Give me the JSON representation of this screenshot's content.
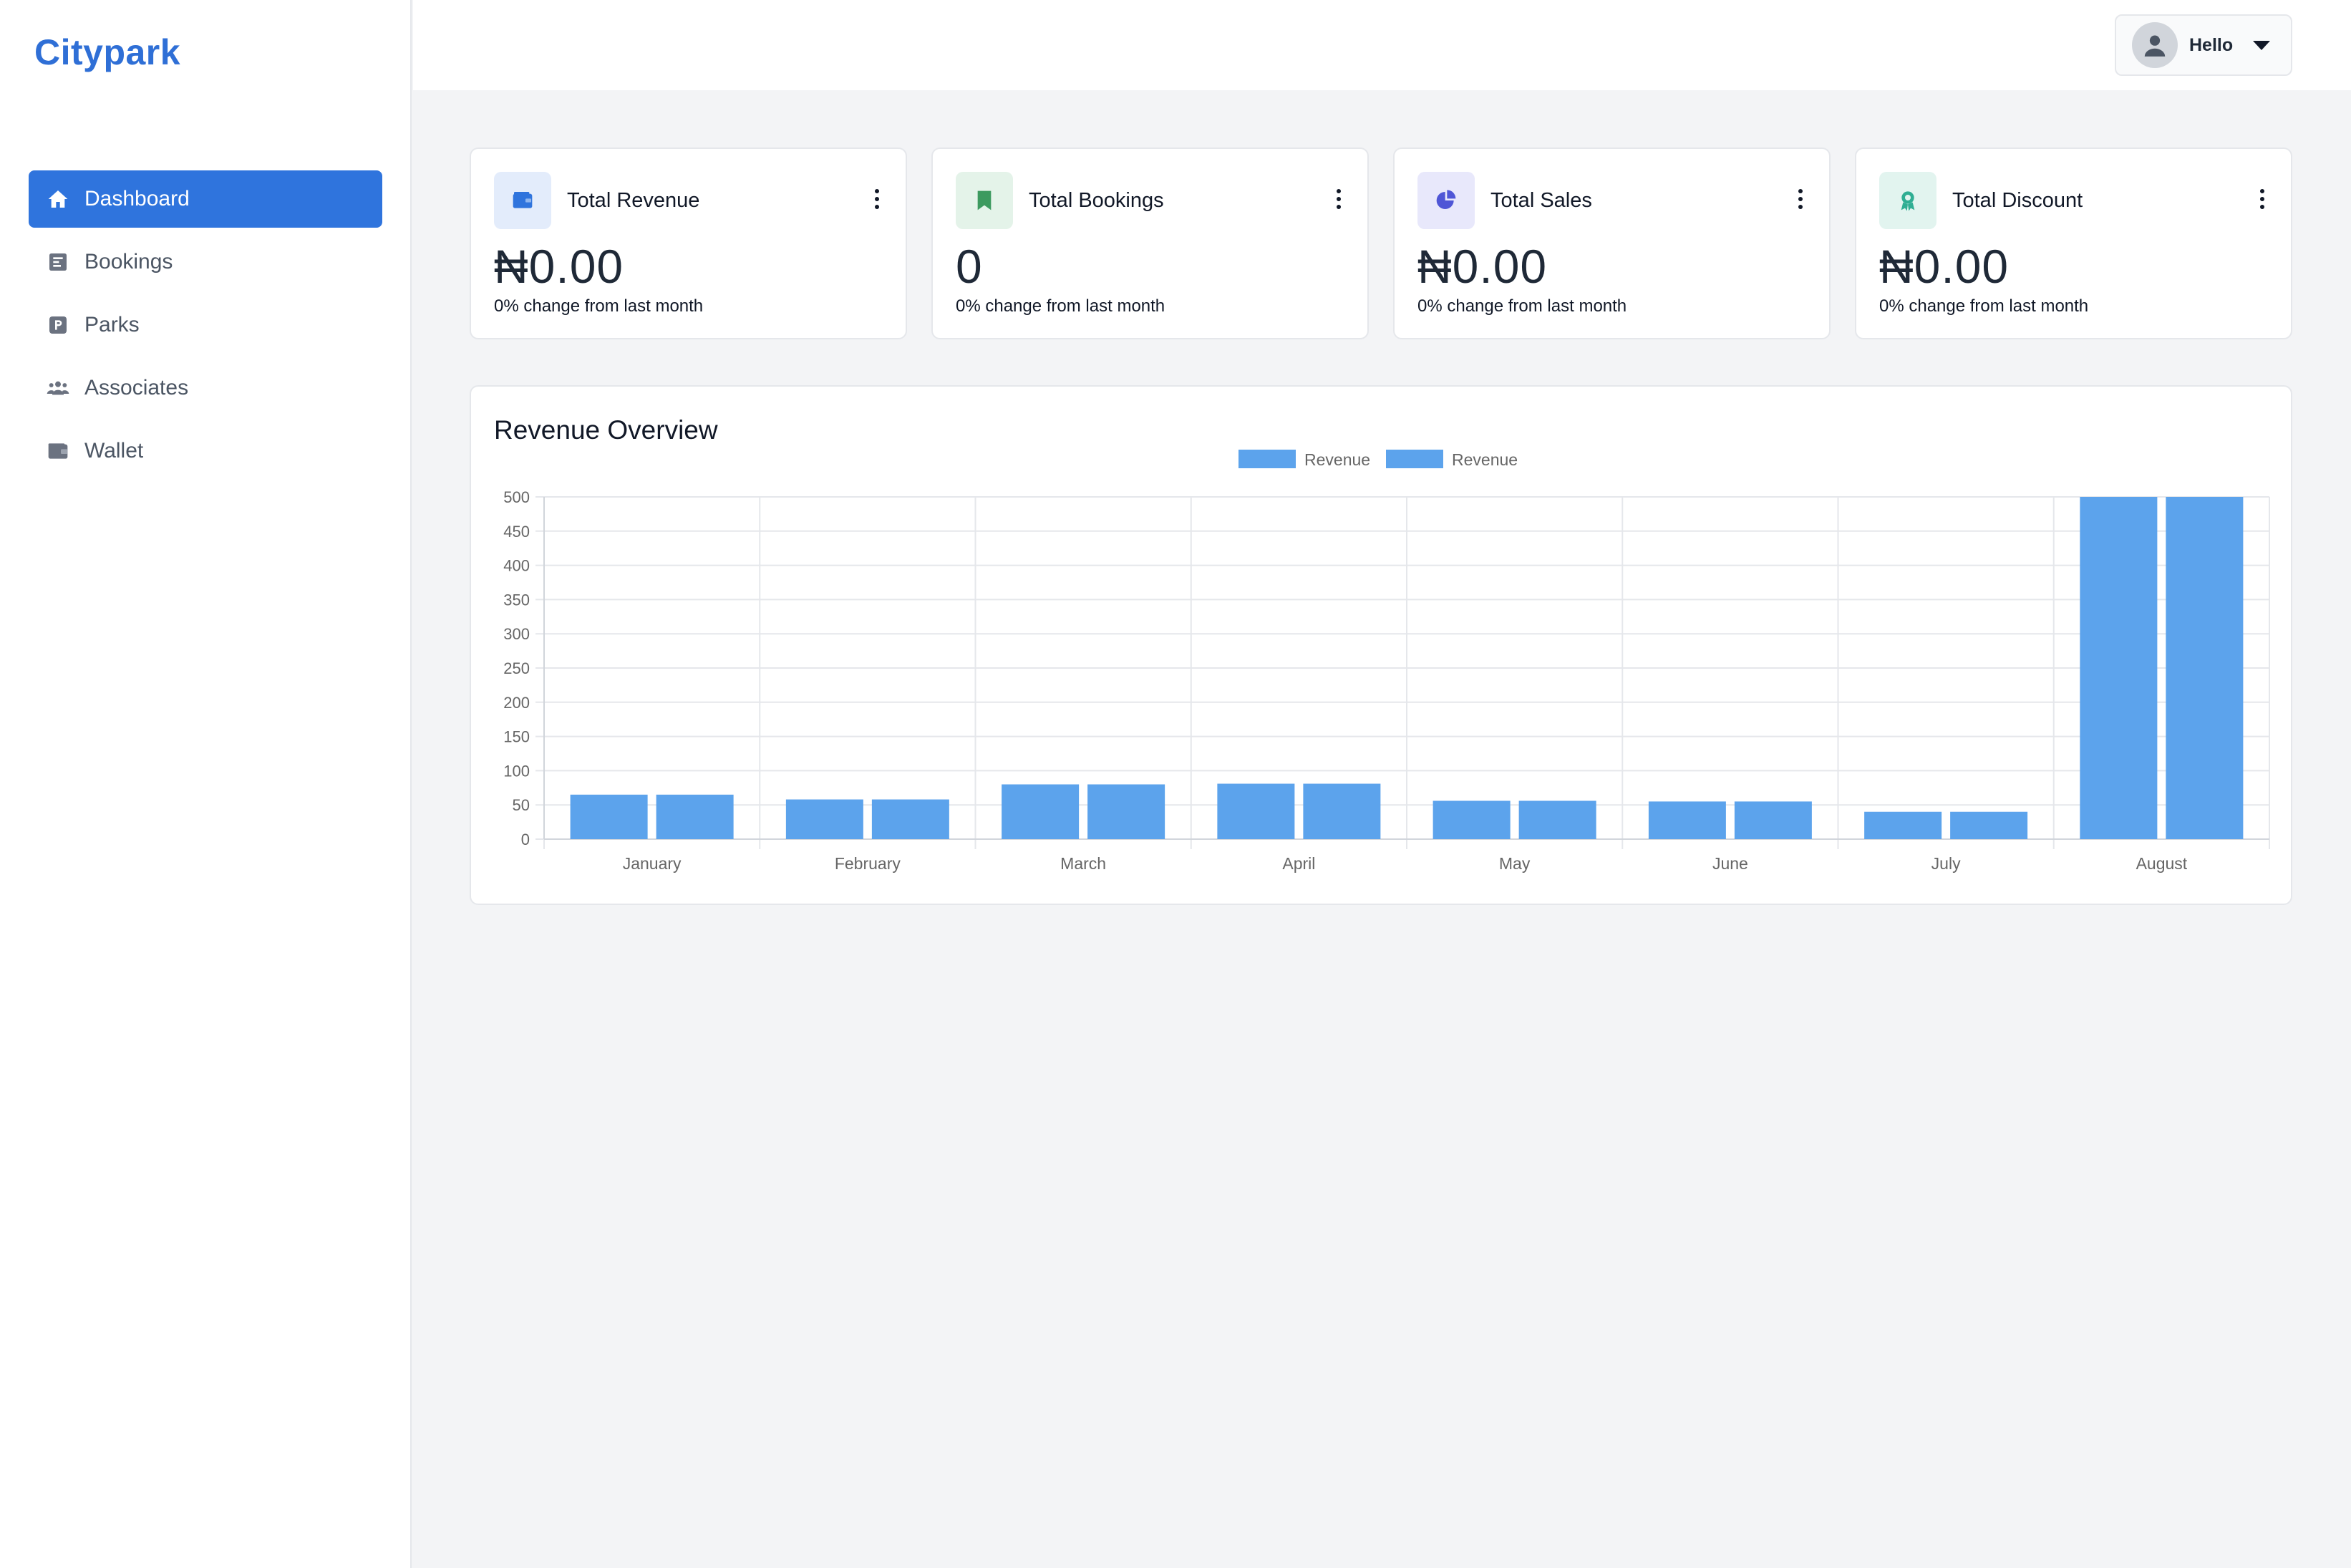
{
  "brand": "Citypark",
  "sidebar": {
    "items": [
      {
        "label": "Dashboard",
        "icon": "home-icon",
        "active": true
      },
      {
        "label": "Bookings",
        "icon": "document-icon",
        "active": false
      },
      {
        "label": "Parks",
        "icon": "parking-icon",
        "active": false
      },
      {
        "label": "Associates",
        "icon": "users-icon",
        "active": false
      },
      {
        "label": "Wallet",
        "icon": "wallet-icon",
        "active": false
      }
    ]
  },
  "user": {
    "greeting": "Hello"
  },
  "cards": [
    {
      "title": "Total Revenue",
      "value": "₦0.00",
      "change": "0% change from last month",
      "icon": "wallet-icon",
      "icon_color": "#2f74dd",
      "icon_bg": "#e3ecfb"
    },
    {
      "title": "Total Bookings",
      "value": "0",
      "change": "0% change from last month",
      "icon": "bookmark-icon",
      "icon_color": "#3c9a5f",
      "icon_bg": "#e4f3e9"
    },
    {
      "title": "Total Sales",
      "value": "₦0.00",
      "change": "0% change from last month",
      "icon": "pie-chart-icon",
      "icon_color": "#4f56d6",
      "icon_bg": "#e8e8fb"
    },
    {
      "title": "Total Discount",
      "value": "₦0.00",
      "change": "0% change from last month",
      "icon": "award-icon",
      "icon_color": "#2fae93",
      "icon_bg": "#e2f4ef"
    }
  ],
  "chart_panel": {
    "title": "Revenue Overview"
  },
  "chart_data": {
    "type": "bar",
    "categories": [
      "January",
      "February",
      "March",
      "April",
      "May",
      "June",
      "July",
      "August"
    ],
    "series": [
      {
        "name": "Revenue",
        "values": [
          65,
          58,
          80,
          81,
          56,
          55,
          40,
          500
        ]
      },
      {
        "name": "Revenue",
        "values": [
          65,
          58,
          80,
          81,
          56,
          55,
          40,
          500
        ]
      }
    ],
    "ylim": [
      0,
      500
    ],
    "yticks": [
      0,
      50,
      100,
      150,
      200,
      250,
      300,
      350,
      400,
      450,
      500
    ],
    "bar_color": "#5ca3ec",
    "grid": true,
    "legend": "top-center"
  }
}
